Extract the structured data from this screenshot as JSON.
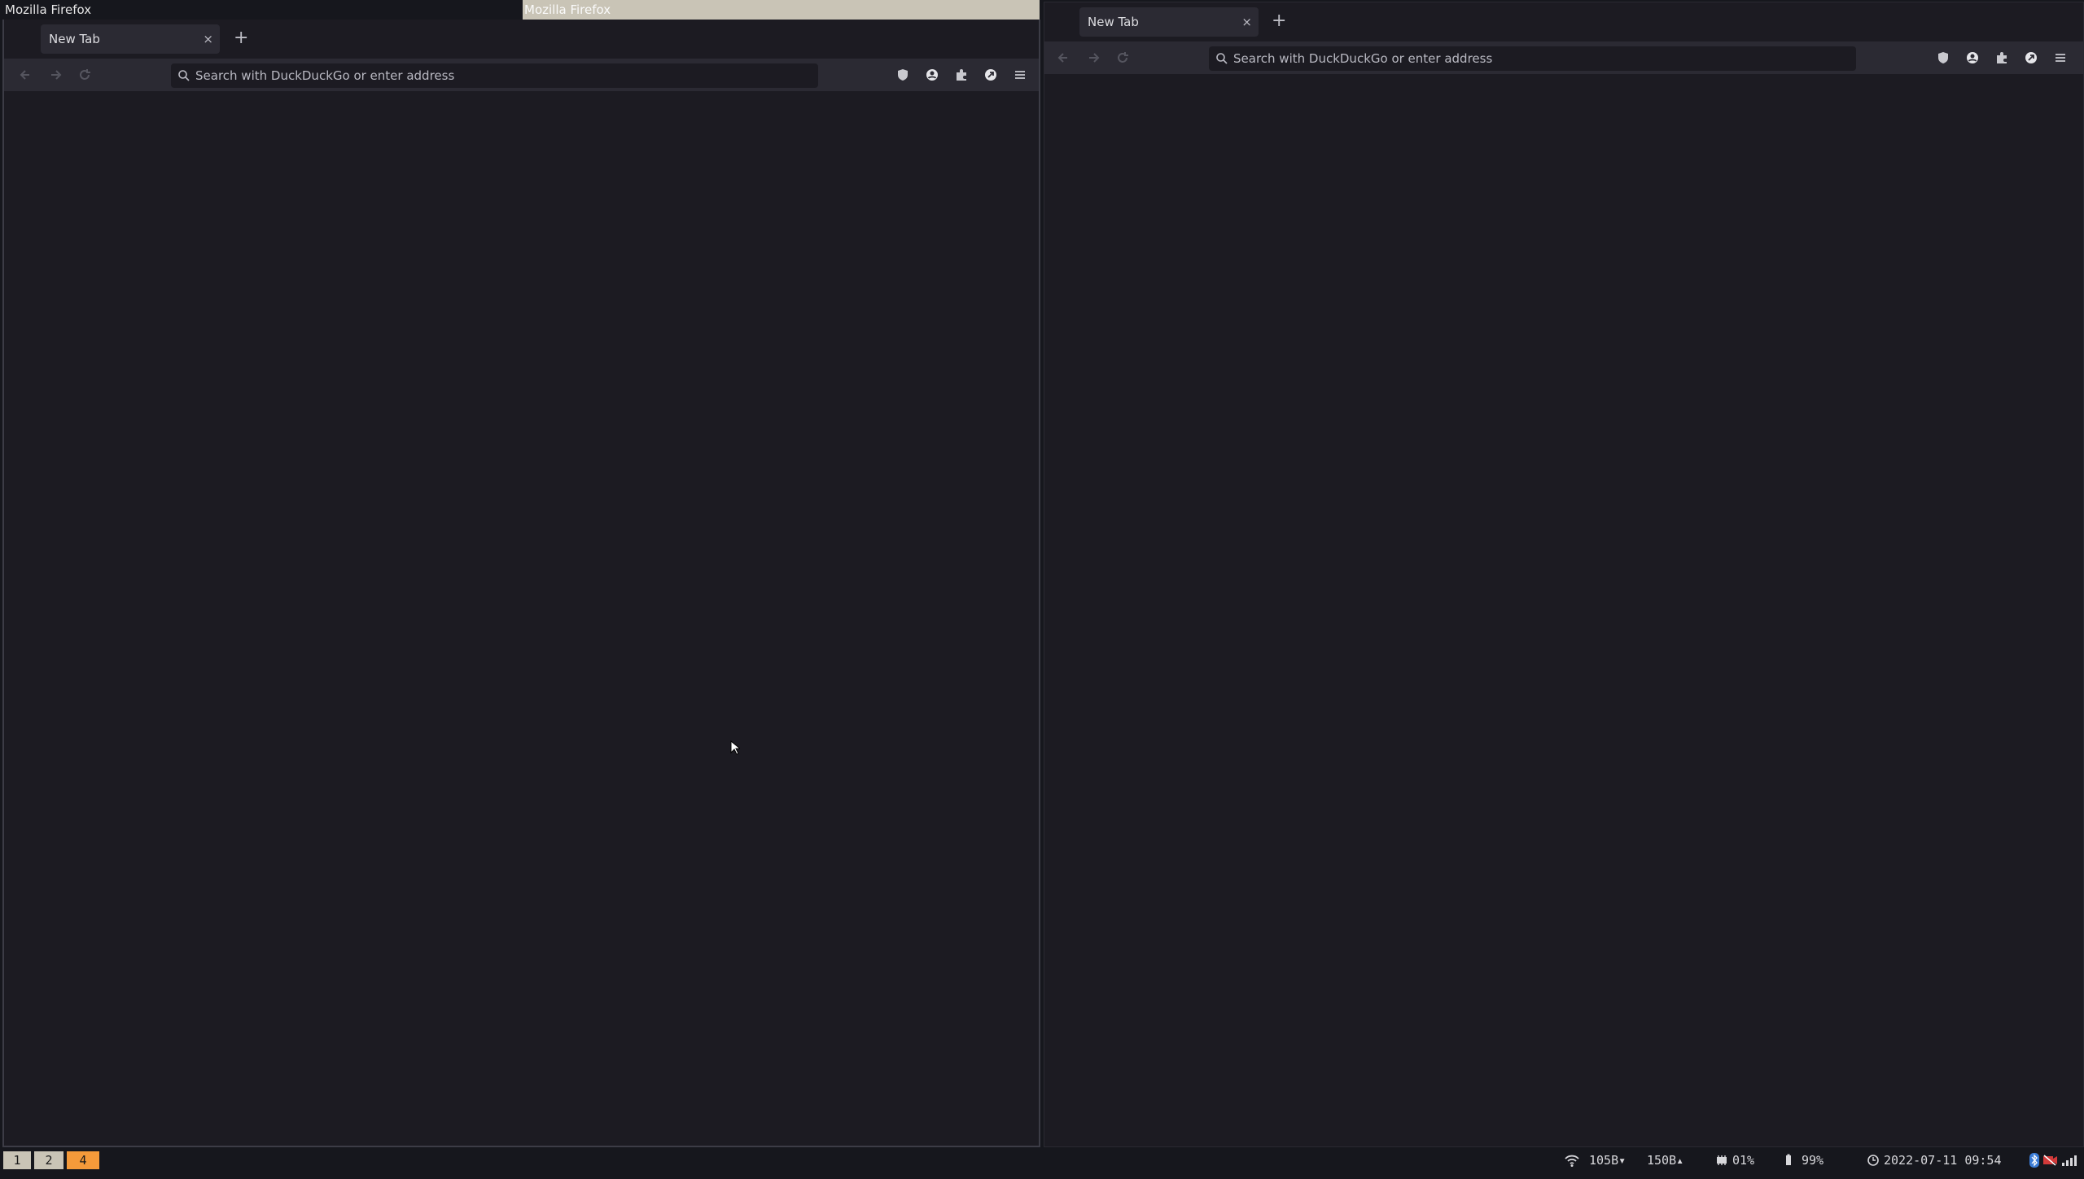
{
  "windows": {
    "left": {
      "title": "Mozilla Firefox",
      "tab_title": "New Tab",
      "tab_close": "×",
      "new_tab": "+",
      "urlbar_placeholder": "Search with DuckDuckGo or enter address"
    },
    "focused_title": "Mozilla Firefox",
    "right": {
      "tab_title": "New Tab",
      "tab_close": "×",
      "new_tab": "+",
      "urlbar_placeholder": "Search with DuckDuckGo or enter address"
    }
  },
  "toolbar_icons": [
    "shield-icon",
    "account-icon",
    "extension-icon",
    "vpn-icon",
    "menu-icon"
  ],
  "statusbar": {
    "workspaces": [
      {
        "label": "1",
        "color": "#c9c4b6"
      },
      {
        "label": "2",
        "color": "#c9c4b6"
      },
      {
        "label": "4",
        "color": "#f59a3a"
      }
    ],
    "net_down": "105B",
    "net_up": "150B",
    "cpu": "01%",
    "battery": "99%",
    "datetime": "2022-07-11 09:54"
  },
  "colors": {
    "background": "#16171d",
    "window": "#1c1b22",
    "toolbar": "#2b2a33",
    "focused_title": "#c9c4b6",
    "workspace_active": "#f59a3a"
  }
}
